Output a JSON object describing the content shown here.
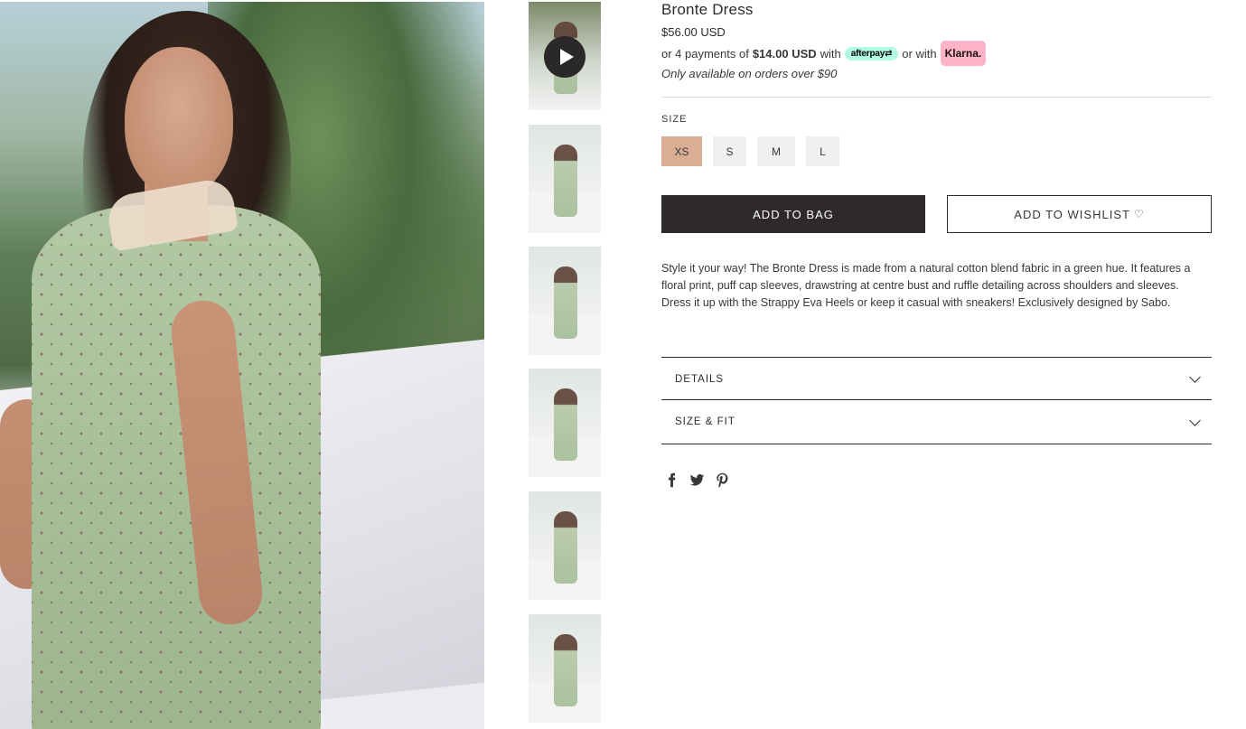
{
  "product": {
    "title": "Bronte Dress",
    "price": "$56.00 USD",
    "installments": {
      "prefix": "or 4 payments of",
      "amount": "$14.00 USD",
      "with1": "with",
      "afterpay_label": "afterpay⇄",
      "with2": "or with",
      "klarna_label": "Klarna."
    },
    "availability": "Only available on orders over $90",
    "size_label": "SIZE",
    "sizes": [
      "XS",
      "S",
      "M",
      "L"
    ],
    "selected_size": "XS",
    "add_to_bag": "ADD TO BAG",
    "add_to_wishlist": "ADD TO WISHLIST",
    "wishlist_icon": "♡",
    "description": "Style it your way! The Bronte Dress is made from a natural cotton blend fabric in a green hue. It features a floral print, puff cap sleeves, drawstring at centre bust and ruffle detailing across shoulders and sleeves. Dress it up with the Strappy Eva Heels or keep it casual with sneakers! Exclusively designed by Sabo.",
    "accordions": [
      {
        "label": "DETAILS"
      },
      {
        "label": "SIZE & FIT"
      }
    ]
  },
  "gallery": {
    "thumbnail_count": 6,
    "first_thumb_has_video": true
  },
  "social": [
    "facebook-icon",
    "twitter-icon",
    "pinterest-icon"
  ],
  "colors": {
    "accent_selected_size": "#d9ae95",
    "primary_button": "#2e2a2b",
    "afterpay": "#b2fce4",
    "klarna": "#ffb3c7"
  }
}
